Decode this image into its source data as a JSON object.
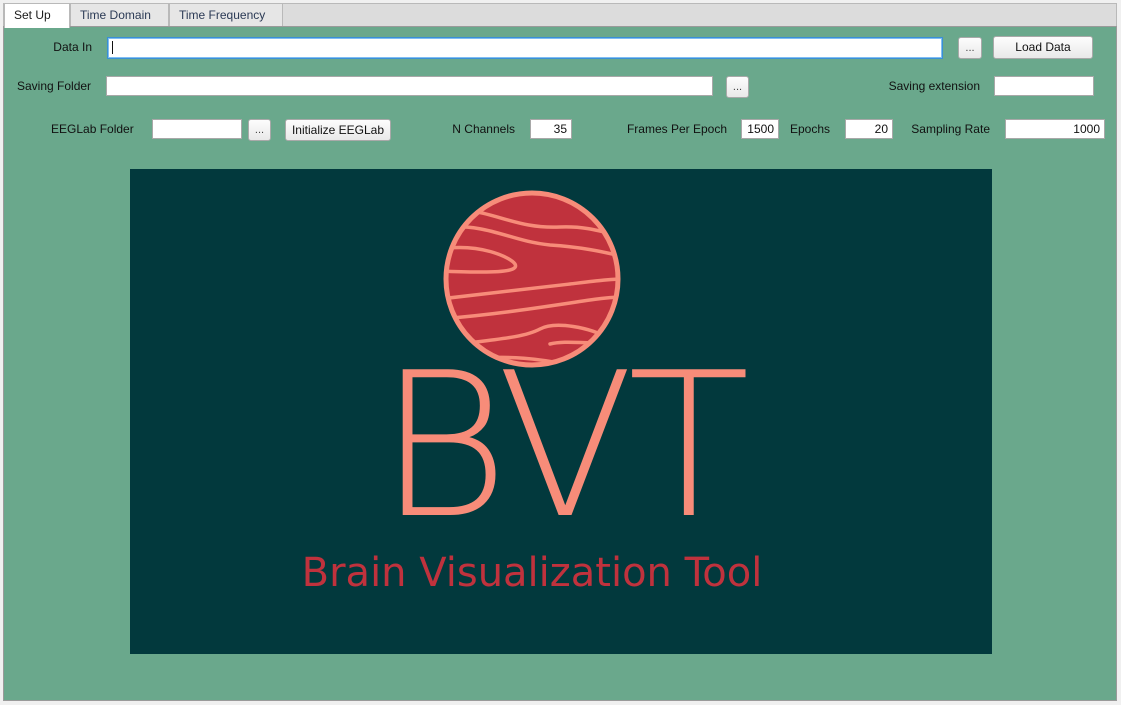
{
  "tabs": [
    {
      "label": "Set Up",
      "active": true
    },
    {
      "label": "Time Domain",
      "active": false
    },
    {
      "label": "Time Frequency",
      "active": false
    }
  ],
  "setup": {
    "data_in": {
      "label": "Data In",
      "value": ""
    },
    "browse_label": "...",
    "load_data_label": "Load Data",
    "saving_folder": {
      "label": "Saving Folder",
      "value": ""
    },
    "saving_extension": {
      "label": "Saving extension",
      "value": ""
    },
    "eeglab_folder": {
      "label": "EEGLab Folder",
      "value": ""
    },
    "initialize_eeglab_label": "Initialize EEGLab",
    "n_channels": {
      "label": "N Channels",
      "value": "35"
    },
    "frames_per_epoch": {
      "label": "Frames Per Epoch",
      "value": "1500"
    },
    "epochs": {
      "label": "Epochs",
      "value": "20"
    },
    "sampling_rate": {
      "label": "Sampling Rate",
      "value": "1000"
    }
  },
  "logo": {
    "text": "BVT",
    "tagline": "Brain Visualization Tool",
    "colors": {
      "background": "#02393d",
      "planet": "#c0323d",
      "accent": "#f78c79",
      "tagline": "#c0323d"
    }
  }
}
